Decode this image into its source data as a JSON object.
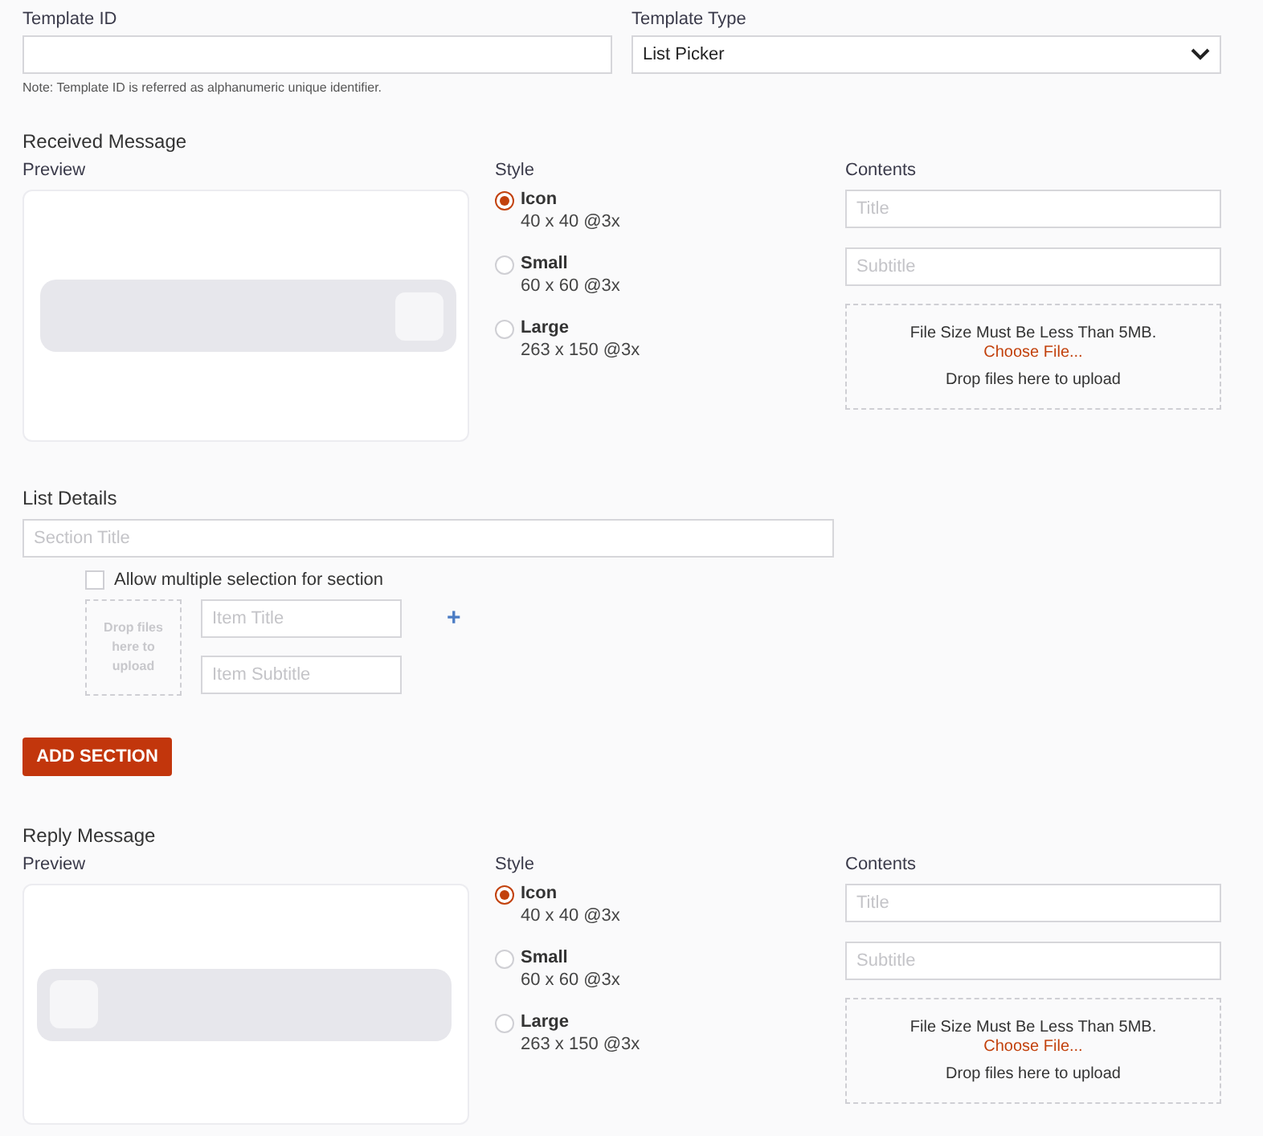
{
  "template_id": {
    "label": "Template ID",
    "note": "Note: Template ID is referred as alphanumeric unique identifier."
  },
  "template_type": {
    "label": "Template Type",
    "value": "List Picker"
  },
  "received_message": {
    "kind": "received",
    "heading": "Received Message",
    "preview_label": "Preview",
    "style_label": "Style",
    "contents_label": "Contents",
    "styles": [
      {
        "name": "Icon",
        "size": "40 x 40 @3x",
        "selected": true
      },
      {
        "name": "Small",
        "size": "60 x 60 @3x",
        "selected": false
      },
      {
        "name": "Large",
        "size": "263 x 150 @3x",
        "selected": false
      }
    ],
    "title_placeholder": "Title",
    "subtitle_placeholder": "Subtitle",
    "upload": {
      "limit": "File Size Must Be Less Than 5MB.",
      "choose": "Choose File...",
      "drop": "Drop files here to upload"
    }
  },
  "list_details": {
    "heading": "List Details",
    "section_title_placeholder": "Section Title",
    "allow_multiple": {
      "label": "Allow multiple selection for section",
      "checked": false
    },
    "item": {
      "drop": "Drop files here to upload",
      "title_placeholder": "Item Title",
      "subtitle_placeholder": "Item Subtitle",
      "add": "+"
    },
    "add_section": "ADD SECTION"
  },
  "reply_message": {
    "kind": "reply",
    "heading": "Reply Message",
    "preview_label": "Preview",
    "style_label": "Style",
    "contents_label": "Contents",
    "styles": [
      {
        "name": "Icon",
        "size": "40 x 40 @3x",
        "selected": true
      },
      {
        "name": "Small",
        "size": "60 x 60 @3x",
        "selected": false
      },
      {
        "name": "Large",
        "size": "263 x 150 @3x",
        "selected": false
      }
    ],
    "title_placeholder": "Title",
    "subtitle_placeholder": "Subtitle",
    "upload": {
      "limit": "File Size Must Be Less Than 5MB.",
      "choose": "Choose File...",
      "drop": "Drop files here to upload"
    }
  }
}
